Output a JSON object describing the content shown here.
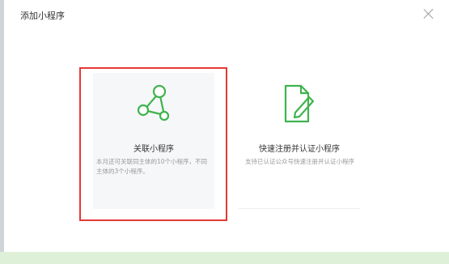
{
  "dialog": {
    "title": "添加小程序",
    "close_icon": "close-icon"
  },
  "cards": [
    {
      "icon": "share-network-icon",
      "title": "关联小程序",
      "description": "本月还可关联同主体的10个小程序，不同主体的3个小程序。",
      "highlighted": true
    },
    {
      "icon": "document-edit-icon",
      "title": "快速注册并认证小程序",
      "description": "支持已认证公众号快速注册并认证小程序"
    }
  ],
  "colors": {
    "icon_green": "#3fb34f",
    "highlight_red": "#e53935",
    "card_bg": "#f6f7f8",
    "bottom_bar": "#dff0d8"
  }
}
